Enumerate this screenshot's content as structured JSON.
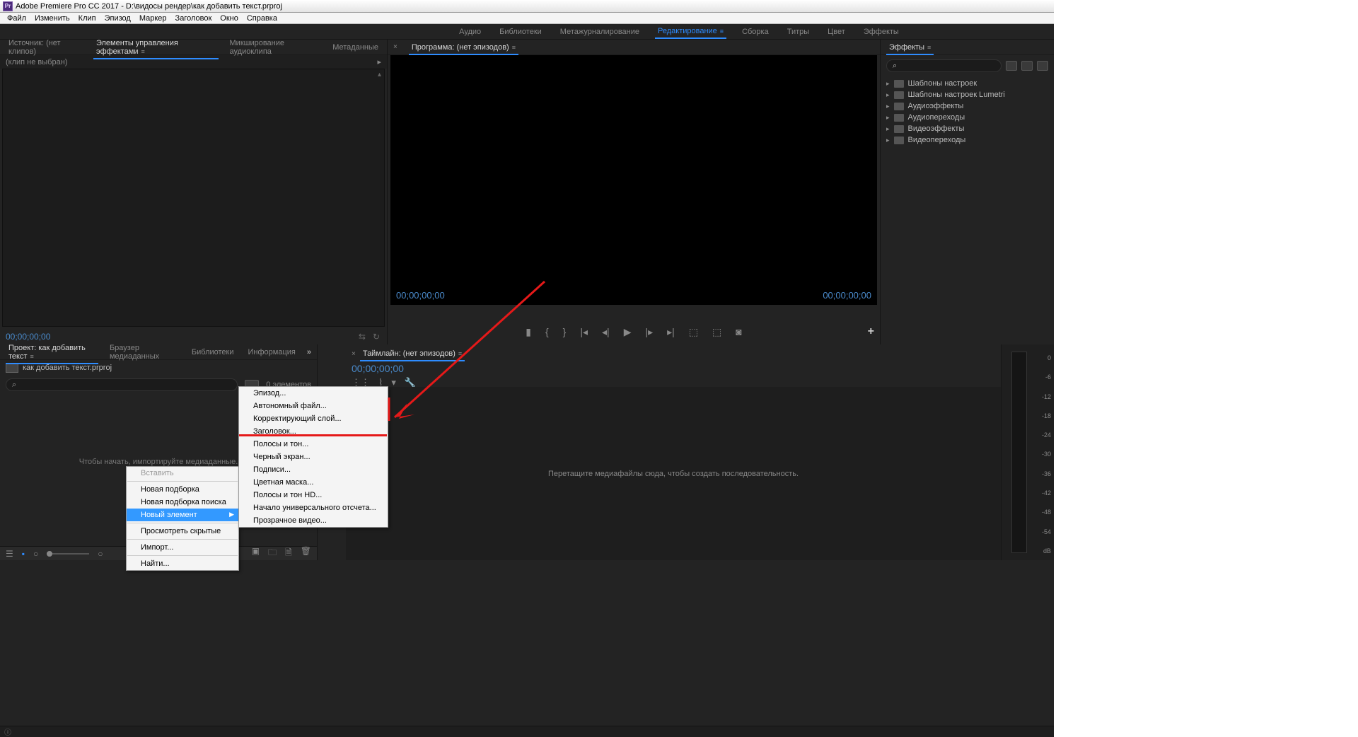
{
  "titlebar": "Adobe Premiere Pro CC 2017 - D:\\видосы рендер\\как добавить текст.prproj",
  "menus": [
    "Файл",
    "Изменить",
    "Клип",
    "Эпизод",
    "Маркер",
    "Заголовок",
    "Окно",
    "Справка"
  ],
  "workspaces": [
    "Аудио",
    "Библиотеки",
    "Метажурналирование",
    "Редактирование",
    "Сборка",
    "Титры",
    "Цвет",
    "Эффекты"
  ],
  "source_tabs": [
    "Источник: (нет клипов)",
    "Элементы управления эффектами",
    "Микширование аудиоклипа",
    "Метаданные"
  ],
  "no_clip": "(клип не выбран)",
  "tc_zero": "00;00;00;00",
  "program_tab": "Программа: (нет эпизодов)",
  "effects_tab": "Эффекты",
  "effects_tree": [
    "Шаблоны настроек",
    "Шаблоны настроек Lumetri",
    "Аудиоэффекты",
    "Аудиопереходы",
    "Видеоэффекты",
    "Видеопереходы"
  ],
  "project_tabs": [
    "Проект: как добавить текст",
    "Браузер медиаданных",
    "Библиотеки",
    "Информация"
  ],
  "project_file": "как добавить текст.prproj",
  "project_count": "0 элементов",
  "project_hint": "Чтобы начать, импортируйте медиаданные.",
  "timeline_tab": "Таймлайн: (нет эпизодов)",
  "timeline_hint": "Перетащите медиафайлы сюда, чтобы создать последовательность.",
  "meter_marks": [
    "0",
    "-6",
    "-12",
    "-18",
    "-24",
    "-30",
    "-36",
    "-42",
    "-48",
    "-54",
    "dB"
  ],
  "ctx1": {
    "items": [
      {
        "l": "Вставить",
        "d": true
      },
      {
        "sep": true
      },
      {
        "l": "Новая подборка"
      },
      {
        "l": "Новая подборка поиска"
      },
      {
        "l": "Новый элемент",
        "sub": true,
        "hl": true
      },
      {
        "sep": true
      },
      {
        "l": "Просмотреть скрытые"
      },
      {
        "sep": true
      },
      {
        "l": "Импорт..."
      },
      {
        "sep": true
      },
      {
        "l": "Найти..."
      }
    ]
  },
  "ctx2": {
    "items": [
      {
        "l": "Эпизод..."
      },
      {
        "l": "Автономный файл..."
      },
      {
        "l": "Корректирующий слой..."
      },
      {
        "l": "Заголовок..."
      },
      {
        "l": "Полосы и тон..."
      },
      {
        "l": "Черный экран..."
      },
      {
        "l": "Подписи..."
      },
      {
        "l": "Цветная маска..."
      },
      {
        "l": "Полосы и тон HD..."
      },
      {
        "l": "Начало универсального отсчета..."
      },
      {
        "l": "Прозрачное видео..."
      }
    ]
  }
}
